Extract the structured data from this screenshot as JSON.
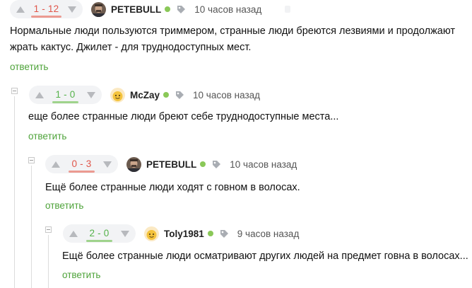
{
  "comments": [
    {
      "rating": {
        "text": "1 - 12",
        "tone": "neg"
      },
      "username": "PETEBULL",
      "avatar": "man-portrait-avatar",
      "time": "10 часов назад",
      "lines": [
        "Нормальные люди пользуются триммером, странные люди бреются лезвиями и продолжают",
        "жрать кактус. Джилет - для труднодоступных мест."
      ],
      "reply": "ответить"
    },
    {
      "rating": {
        "text": "1 - 0",
        "tone": "pos"
      },
      "username": "McZay",
      "avatar": "yellow-face-avatar",
      "time": "10 часов назад",
      "lines": [
        "еще более странные люди бреют себе труднодоступные места..."
      ],
      "reply": "ответить"
    },
    {
      "rating": {
        "text": "0 - 3",
        "tone": "neg"
      },
      "username": "PETEBULL",
      "avatar": "man-portrait-avatar",
      "time": "10 часов назад",
      "lines": [
        "Ещё более странные люди ходят с говном в волосах."
      ],
      "reply": "ответить"
    },
    {
      "rating": {
        "text": "2 - 0",
        "tone": "pos"
      },
      "username": "Toly1981",
      "avatar": "yellow-face-avatar",
      "time": "9 часов назад",
      "lines": [
        "Ещё более странные люди осматривают других людей на предмет говна в волосах..."
      ],
      "reply": "ответить"
    }
  ],
  "colors": {
    "accent_green": "#4ea33a",
    "negative": "#e0564a",
    "positive": "#55b24a",
    "online": "#8ac858"
  }
}
